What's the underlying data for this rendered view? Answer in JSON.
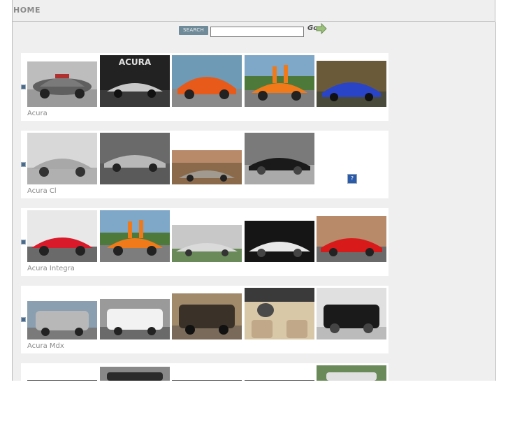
{
  "header": {
    "home_label": "HOME"
  },
  "search": {
    "button_label": "SEARCH",
    "value": "",
    "go_label": "Go"
  },
  "rows": [
    {
      "label": "Acura",
      "thumbs": [
        "silver-concept-car",
        "acura-logo-concept",
        "orange-sports-car",
        "orange-lambo-doors",
        "blue-sports-car"
      ]
    },
    {
      "label": "Acura Cl",
      "thumbs": [
        "silver-coupe",
        "silver-coupe-side",
        "silver-coupe-driveway",
        "black-coupe-garage"
      ],
      "missing_icon": "?"
    },
    {
      "label": "Acura Integra",
      "thumbs": [
        "red-integra",
        "orange-lambo-doors",
        "silver-integra",
        "white-integra",
        "red-integra-front"
      ]
    },
    {
      "label": "Acura Mdx",
      "thumbs": [
        "silver-suv",
        "white-suv",
        "dark-suv",
        "suv-interior",
        "black-suv"
      ]
    }
  ],
  "colors": {
    "link_gray": "#8a8a8a",
    "button_blue": "#6f8a98",
    "page_bg": "#efefef"
  }
}
